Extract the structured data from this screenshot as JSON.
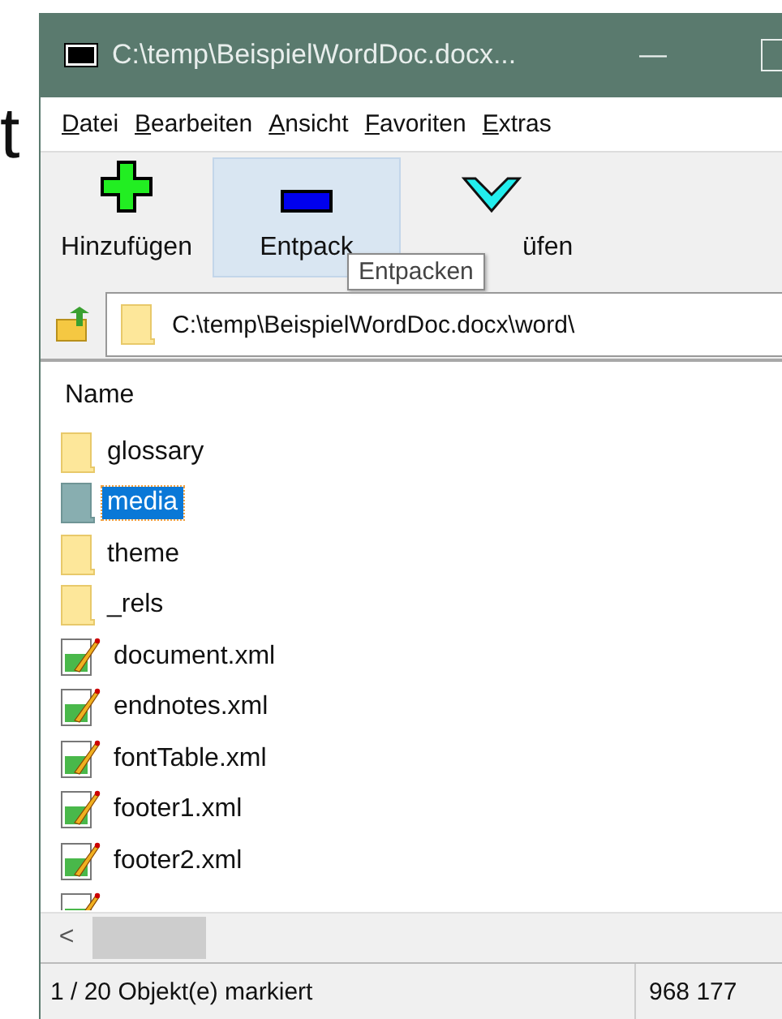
{
  "background_text": "t",
  "window": {
    "title": "C:\\temp\\BeispielWordDoc.docx...",
    "minimize": "—"
  },
  "menu": [
    {
      "label": "Datei"
    },
    {
      "label": "Bearbeiten"
    },
    {
      "label": "Ansicht"
    },
    {
      "label": "Favoriten"
    },
    {
      "label": "Extras"
    }
  ],
  "toolbar": [
    {
      "kind": "add",
      "label": "Hinzufügen",
      "hovered": false
    },
    {
      "kind": "extract",
      "label": "Entpack",
      "hovered": true
    },
    {
      "kind": "test",
      "label": "üfen",
      "hovered": false
    }
  ],
  "tooltip": "Entpacken",
  "address": "C:\\temp\\BeispielWordDoc.docx\\word\\",
  "list": {
    "column": "Name",
    "rows": [
      {
        "kind": "folder",
        "name": "glossary",
        "selected": false
      },
      {
        "kind": "folder",
        "name": "media",
        "selected": true
      },
      {
        "kind": "folder",
        "name": "theme",
        "selected": false
      },
      {
        "kind": "folder",
        "name": "_rels",
        "selected": false
      },
      {
        "kind": "file",
        "name": "document.xml",
        "selected": false
      },
      {
        "kind": "file",
        "name": "endnotes.xml",
        "selected": false
      },
      {
        "kind": "file",
        "name": "fontTable.xml",
        "selected": false
      },
      {
        "kind": "file",
        "name": "footer1.xml",
        "selected": false
      },
      {
        "kind": "file",
        "name": "footer2.xml",
        "selected": false
      }
    ]
  },
  "scroll_left": "<",
  "status_bar": {
    "selection": "1 / 20 Objekt(e) markiert",
    "size": "968 177"
  }
}
